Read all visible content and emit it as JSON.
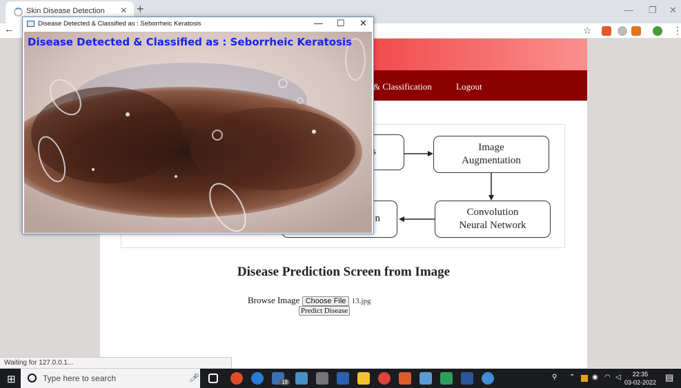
{
  "browser": {
    "tab_title": "Skin Disease Detection",
    "tab_close": "×",
    "new_tab": "+",
    "back_arrow": "←",
    "win_minimize": "—",
    "win_restore": "❐",
    "win_close": "✕",
    "star": "☆",
    "menu": "⋮",
    "status_text": "Waiting for 127.0.0.1..."
  },
  "page": {
    "nav": {
      "classification": "& Classification",
      "logout": "Logout"
    },
    "diagram": {
      "image_augmentation": "Image\nAugmentation",
      "convolution": "Convolution\nNeural Network",
      "partial_left_top": "s",
      "partial_left_bottom": "n"
    },
    "prediction_title": "Disease Prediction Screen from Image",
    "browse_label": "Browse Image",
    "choose_file": "Choose File",
    "file_name": "13.jpg",
    "predict_button": "Predict Disease"
  },
  "popup": {
    "window_title": "Disease Detected & Classified as : Seborrheic Keratosis",
    "caption": "Disease Detected & Classified as : Seborrheic Keratosis",
    "minimize": "—",
    "maximize": "☐",
    "close": "✕"
  },
  "taskbar": {
    "search_placeholder": "Type here to search",
    "time": "22:35",
    "date": "03-02-2022",
    "badge": "18"
  },
  "colors": {
    "header_red": "#d41616",
    "nav_dark_red": "#8c0000",
    "caption_blue": "#1424e6"
  }
}
